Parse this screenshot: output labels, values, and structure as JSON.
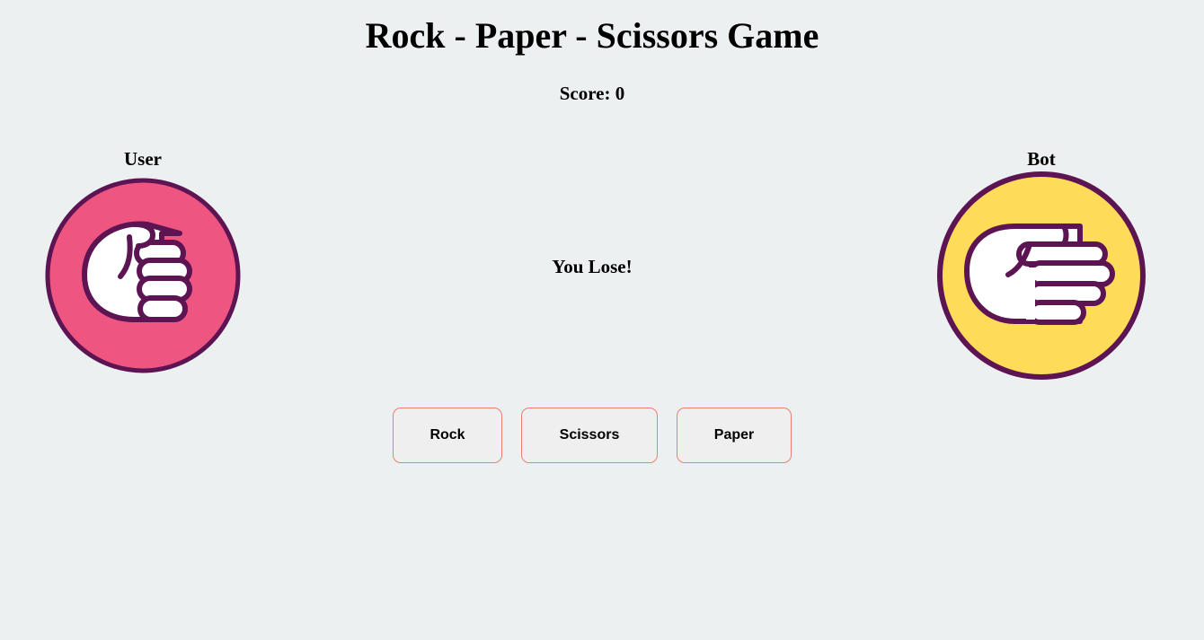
{
  "header": {
    "title": "Rock - Paper - Scissors Game",
    "score_text": "Score: 0"
  },
  "players": {
    "user": {
      "label": "User",
      "choice_icon": "rock-hand-icon",
      "circle_color": "#ef5581"
    },
    "bot": {
      "label": "Bot",
      "choice_icon": "paper-hand-icon",
      "circle_color": "#ffdb5a"
    }
  },
  "result": {
    "text": "You Lose!"
  },
  "controls": {
    "rock_label": "Rock",
    "scissors_label": "Scissors",
    "paper_label": "Paper"
  },
  "colors": {
    "background": "#ecf0f1",
    "outline": "#5c1452",
    "button_border": "#e8806f",
    "button_fill": "#efefef"
  }
}
